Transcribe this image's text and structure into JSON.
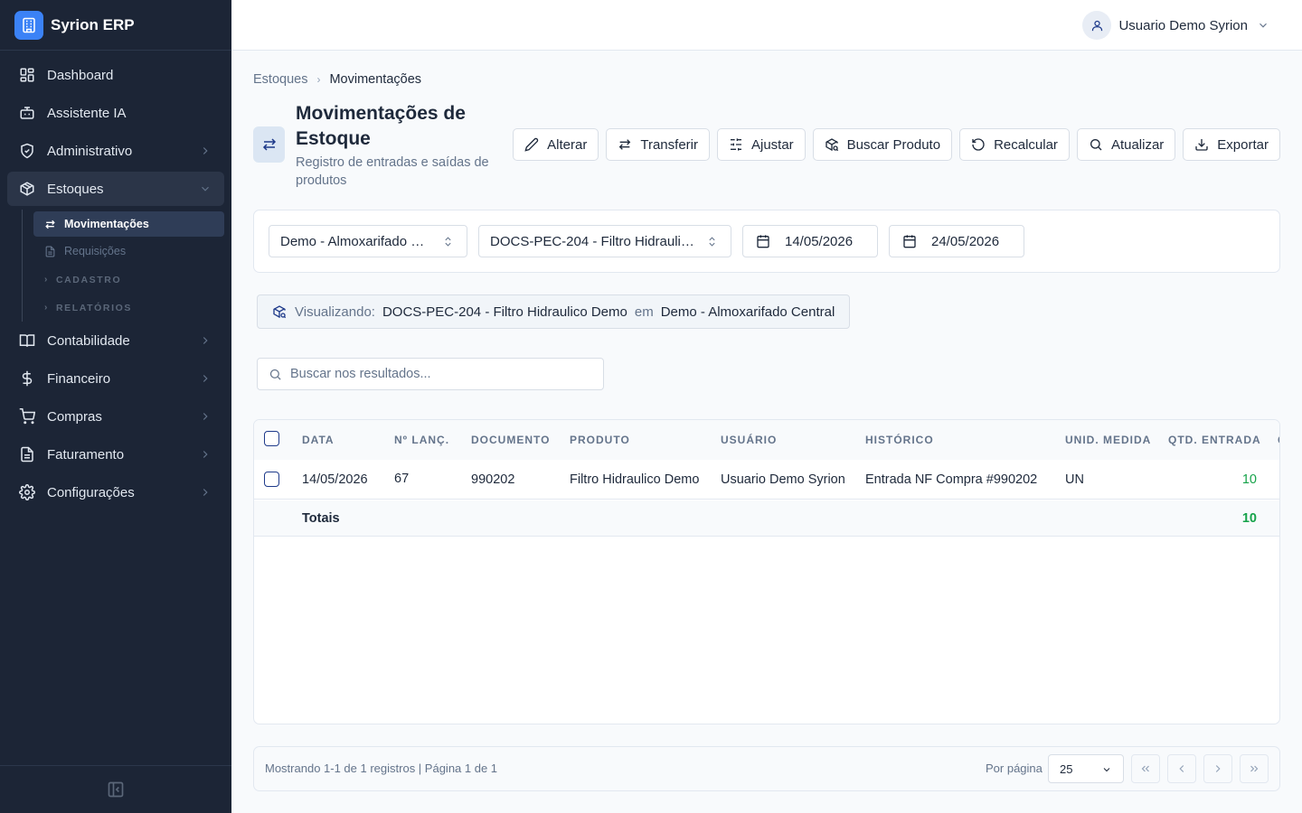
{
  "app": {
    "name": "Syrion ERP"
  },
  "sidebar": {
    "items": [
      {
        "label": "Dashboard",
        "icon": "dashboard-icon"
      },
      {
        "label": "Assistente IA",
        "icon": "bot-icon"
      },
      {
        "label": "Administrativo",
        "icon": "shield-icon"
      },
      {
        "label": "Estoques",
        "icon": "package-icon",
        "expanded": true
      },
      {
        "label": "Contabilidade",
        "icon": "book-icon"
      },
      {
        "label": "Financeiro",
        "icon": "dollar-icon"
      },
      {
        "label": "Compras",
        "icon": "cart-icon"
      },
      {
        "label": "Faturamento",
        "icon": "invoice-icon"
      },
      {
        "label": "Configurações",
        "icon": "gear-icon"
      }
    ],
    "estoques_sub": {
      "movimentacoes": "Movimentações",
      "requisicoes": "Requisições",
      "cadastro": "CADASTRO",
      "relatorios": "RELATÓRIOS"
    }
  },
  "header": {
    "user_name": "Usuario Demo Syrion"
  },
  "breadcrumb": {
    "parent": "Estoques",
    "current": "Movimentações"
  },
  "page": {
    "title": "Movimentações de Estoque",
    "subtitle": "Registro de entradas e saídas de produtos"
  },
  "toolbar": {
    "alterar": "Alterar",
    "transferir": "Transferir",
    "ajustar": "Ajustar",
    "buscar_produto": "Buscar Produto",
    "recalcular": "Recalcular",
    "atualizar": "Atualizar",
    "exportar": "Exportar"
  },
  "filters": {
    "almoxarifado": "Demo - Almoxarifado Central",
    "produto": "DOCS-PEC-204 - Filtro Hidraulico Demo",
    "data_inicio": "14/05/2026",
    "data_fim": "24/05/2026"
  },
  "viewing": {
    "label": "Visualizando:",
    "produto": "DOCS-PEC-204 - Filtro Hidraulico Demo",
    "em": "em",
    "local": "Demo - Almoxarifado Central"
  },
  "search": {
    "placeholder": "Buscar nos resultados..."
  },
  "table": {
    "columns": {
      "data": "DATA",
      "n_lanc": "Nº LANÇ.",
      "documento": "DOCUMENTO",
      "produto": "PRODUTO",
      "usuario": "USUÁRIO",
      "historico": "HISTÓRICO",
      "unid": "UNID. MEDIDA",
      "qtd_entrada": "QTD. ENTRADA",
      "next": "Q"
    },
    "rows": [
      {
        "data": "14/05/2026",
        "n_lanc": "67",
        "documento": "990202",
        "produto": "Filtro Hidraulico Demo",
        "usuario": "Usuario Demo Syrion",
        "historico": "Entrada NF Compra #990202",
        "unid": "UN",
        "qtd_entrada": "10"
      }
    ],
    "totals": {
      "label": "Totais",
      "qtd_entrada": "10"
    }
  },
  "pagination": {
    "info": "Mostrando 1-1 de 1 registros | Página 1 de 1",
    "per_page_label": "Por página",
    "per_page": "25"
  },
  "colors": {
    "sidebar_bg": "#1c2536",
    "accent": "#3b82f6",
    "positive": "#16a34a"
  }
}
